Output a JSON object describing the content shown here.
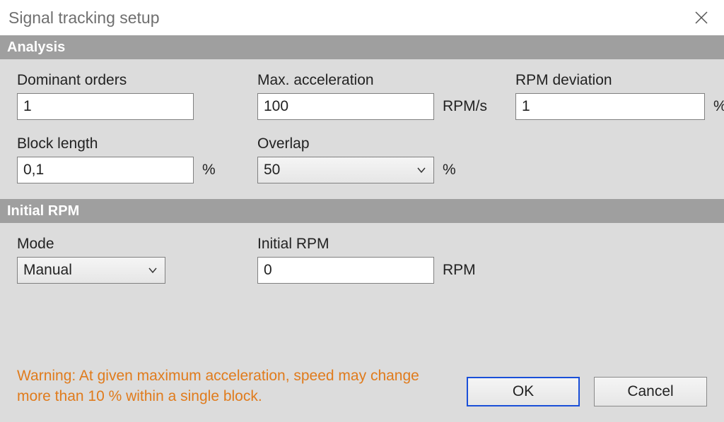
{
  "title": "Signal tracking setup",
  "sections": {
    "analysis": {
      "header": "Analysis",
      "dominant_orders": {
        "label": "Dominant orders",
        "value": "1"
      },
      "max_acceleration": {
        "label": "Max. acceleration",
        "value": "100",
        "unit": "RPM/s"
      },
      "rpm_deviation": {
        "label": "RPM deviation",
        "value": "1",
        "unit": "%"
      },
      "block_length": {
        "label": "Block length",
        "value": "0,1",
        "unit": "%"
      },
      "overlap": {
        "label": "Overlap",
        "value": "50",
        "unit": "%"
      }
    },
    "initial_rpm": {
      "header": "Initial RPM",
      "mode": {
        "label": "Mode",
        "value": "Manual"
      },
      "initial_rpm_field": {
        "label": "Initial RPM",
        "value": "0",
        "unit": "RPM"
      }
    }
  },
  "warning": "Warning: At given maximum acceleration, speed may change more than 10 % within a single block.",
  "buttons": {
    "ok": "OK",
    "cancel": "Cancel"
  }
}
